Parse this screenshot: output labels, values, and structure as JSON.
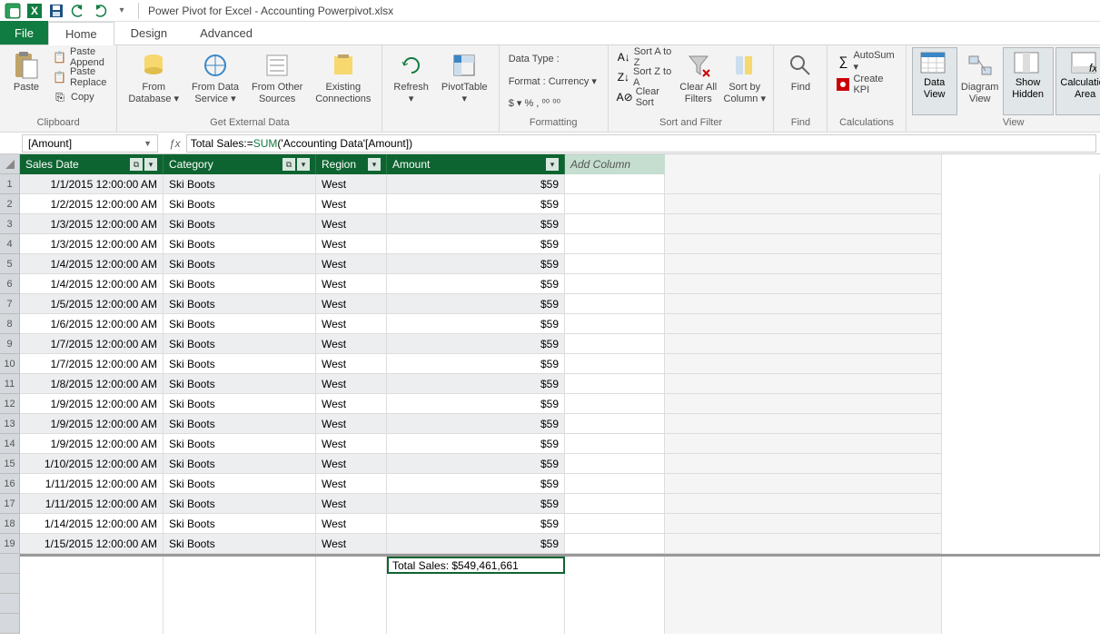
{
  "title": "Power Pivot for Excel - Accounting Powerpivot.xlsx",
  "tabs": {
    "file": "File",
    "home": "Home",
    "design": "Design",
    "advanced": "Advanced"
  },
  "ribbon": {
    "clipboard": {
      "label": "Clipboard",
      "paste": "Paste",
      "pasteAppend": "Paste Append",
      "pasteReplace": "Paste Replace",
      "copy": "Copy"
    },
    "getdata": {
      "label": "Get External Data",
      "fromDb": "From\nDatabase ▾",
      "fromDs": "From Data\nService ▾",
      "fromOther": "From Other\nSources",
      "existing": "Existing\nConnections"
    },
    "refresh": "Refresh\n▾",
    "pivot": "PivotTable\n▾",
    "formatting": {
      "label": "Formatting",
      "dataType": "Data Type :",
      "format": "Format : Currency ▾",
      "symbols": "$ ▾  %  ,  ⁰⁰  ⁰⁰"
    },
    "sort": {
      "label": "Sort and Filter",
      "az": "Sort A to Z",
      "za": "Sort Z to A",
      "clear": "Clear Sort",
      "clearAll": "Clear All\nFilters",
      "sortBy": "Sort by\nColumn ▾"
    },
    "find": {
      "label": "Find",
      "btn": "Find"
    },
    "calc": {
      "label": "Calculations",
      "autosum": "AutoSum ▾",
      "kpi": "Create KPI"
    },
    "view": {
      "label": "View",
      "data": "Data\nView",
      "diagram": "Diagram\nView",
      "hidden": "Show\nHidden",
      "calc": "Calculation\nArea"
    }
  },
  "namebox": "[Amount]",
  "formulaPrefix": "Total Sales:=",
  "formulaFunc": "SUM",
  "formulaArgs": "('Accounting Data'[Amount])",
  "columns": {
    "date": "Sales Date",
    "cat": "Category",
    "reg": "Region",
    "amt": "Amount",
    "add": "Add Column"
  },
  "rows": [
    {
      "n": 1,
      "date": "1/1/2015 12:00:00 AM",
      "cat": "Ski Boots",
      "reg": "West",
      "amt": "$59"
    },
    {
      "n": 2,
      "date": "1/2/2015 12:00:00 AM",
      "cat": "Ski Boots",
      "reg": "West",
      "amt": "$59"
    },
    {
      "n": 3,
      "date": "1/3/2015 12:00:00 AM",
      "cat": "Ski Boots",
      "reg": "West",
      "amt": "$59"
    },
    {
      "n": 4,
      "date": "1/3/2015 12:00:00 AM",
      "cat": "Ski Boots",
      "reg": "West",
      "amt": "$59"
    },
    {
      "n": 5,
      "date": "1/4/2015 12:00:00 AM",
      "cat": "Ski Boots",
      "reg": "West",
      "amt": "$59"
    },
    {
      "n": 6,
      "date": "1/4/2015 12:00:00 AM",
      "cat": "Ski Boots",
      "reg": "West",
      "amt": "$59"
    },
    {
      "n": 7,
      "date": "1/5/2015 12:00:00 AM",
      "cat": "Ski Boots",
      "reg": "West",
      "amt": "$59"
    },
    {
      "n": 8,
      "date": "1/6/2015 12:00:00 AM",
      "cat": "Ski Boots",
      "reg": "West",
      "amt": "$59"
    },
    {
      "n": 9,
      "date": "1/7/2015 12:00:00 AM",
      "cat": "Ski Boots",
      "reg": "West",
      "amt": "$59"
    },
    {
      "n": 10,
      "date": "1/7/2015 12:00:00 AM",
      "cat": "Ski Boots",
      "reg": "West",
      "amt": "$59"
    },
    {
      "n": 11,
      "date": "1/8/2015 12:00:00 AM",
      "cat": "Ski Boots",
      "reg": "West",
      "amt": "$59"
    },
    {
      "n": 12,
      "date": "1/9/2015 12:00:00 AM",
      "cat": "Ski Boots",
      "reg": "West",
      "amt": "$59"
    },
    {
      "n": 13,
      "date": "1/9/2015 12:00:00 AM",
      "cat": "Ski Boots",
      "reg": "West",
      "amt": "$59"
    },
    {
      "n": 14,
      "date": "1/9/2015 12:00:00 AM",
      "cat": "Ski Boots",
      "reg": "West",
      "amt": "$59"
    },
    {
      "n": 15,
      "date": "1/10/2015 12:00:00 AM",
      "cat": "Ski Boots",
      "reg": "West",
      "amt": "$59"
    },
    {
      "n": 16,
      "date": "1/11/2015 12:00:00 AM",
      "cat": "Ski Boots",
      "reg": "West",
      "amt": "$59"
    },
    {
      "n": 17,
      "date": "1/11/2015 12:00:00 AM",
      "cat": "Ski Boots",
      "reg": "West",
      "amt": "$59"
    },
    {
      "n": 18,
      "date": "1/14/2015 12:00:00 AM",
      "cat": "Ski Boots",
      "reg": "West",
      "amt": "$59"
    },
    {
      "n": 19,
      "date": "1/15/2015 12:00:00 AM",
      "cat": "Ski Boots",
      "reg": "West",
      "amt": "$59"
    }
  ],
  "measure": "Total Sales: $549,461,661"
}
